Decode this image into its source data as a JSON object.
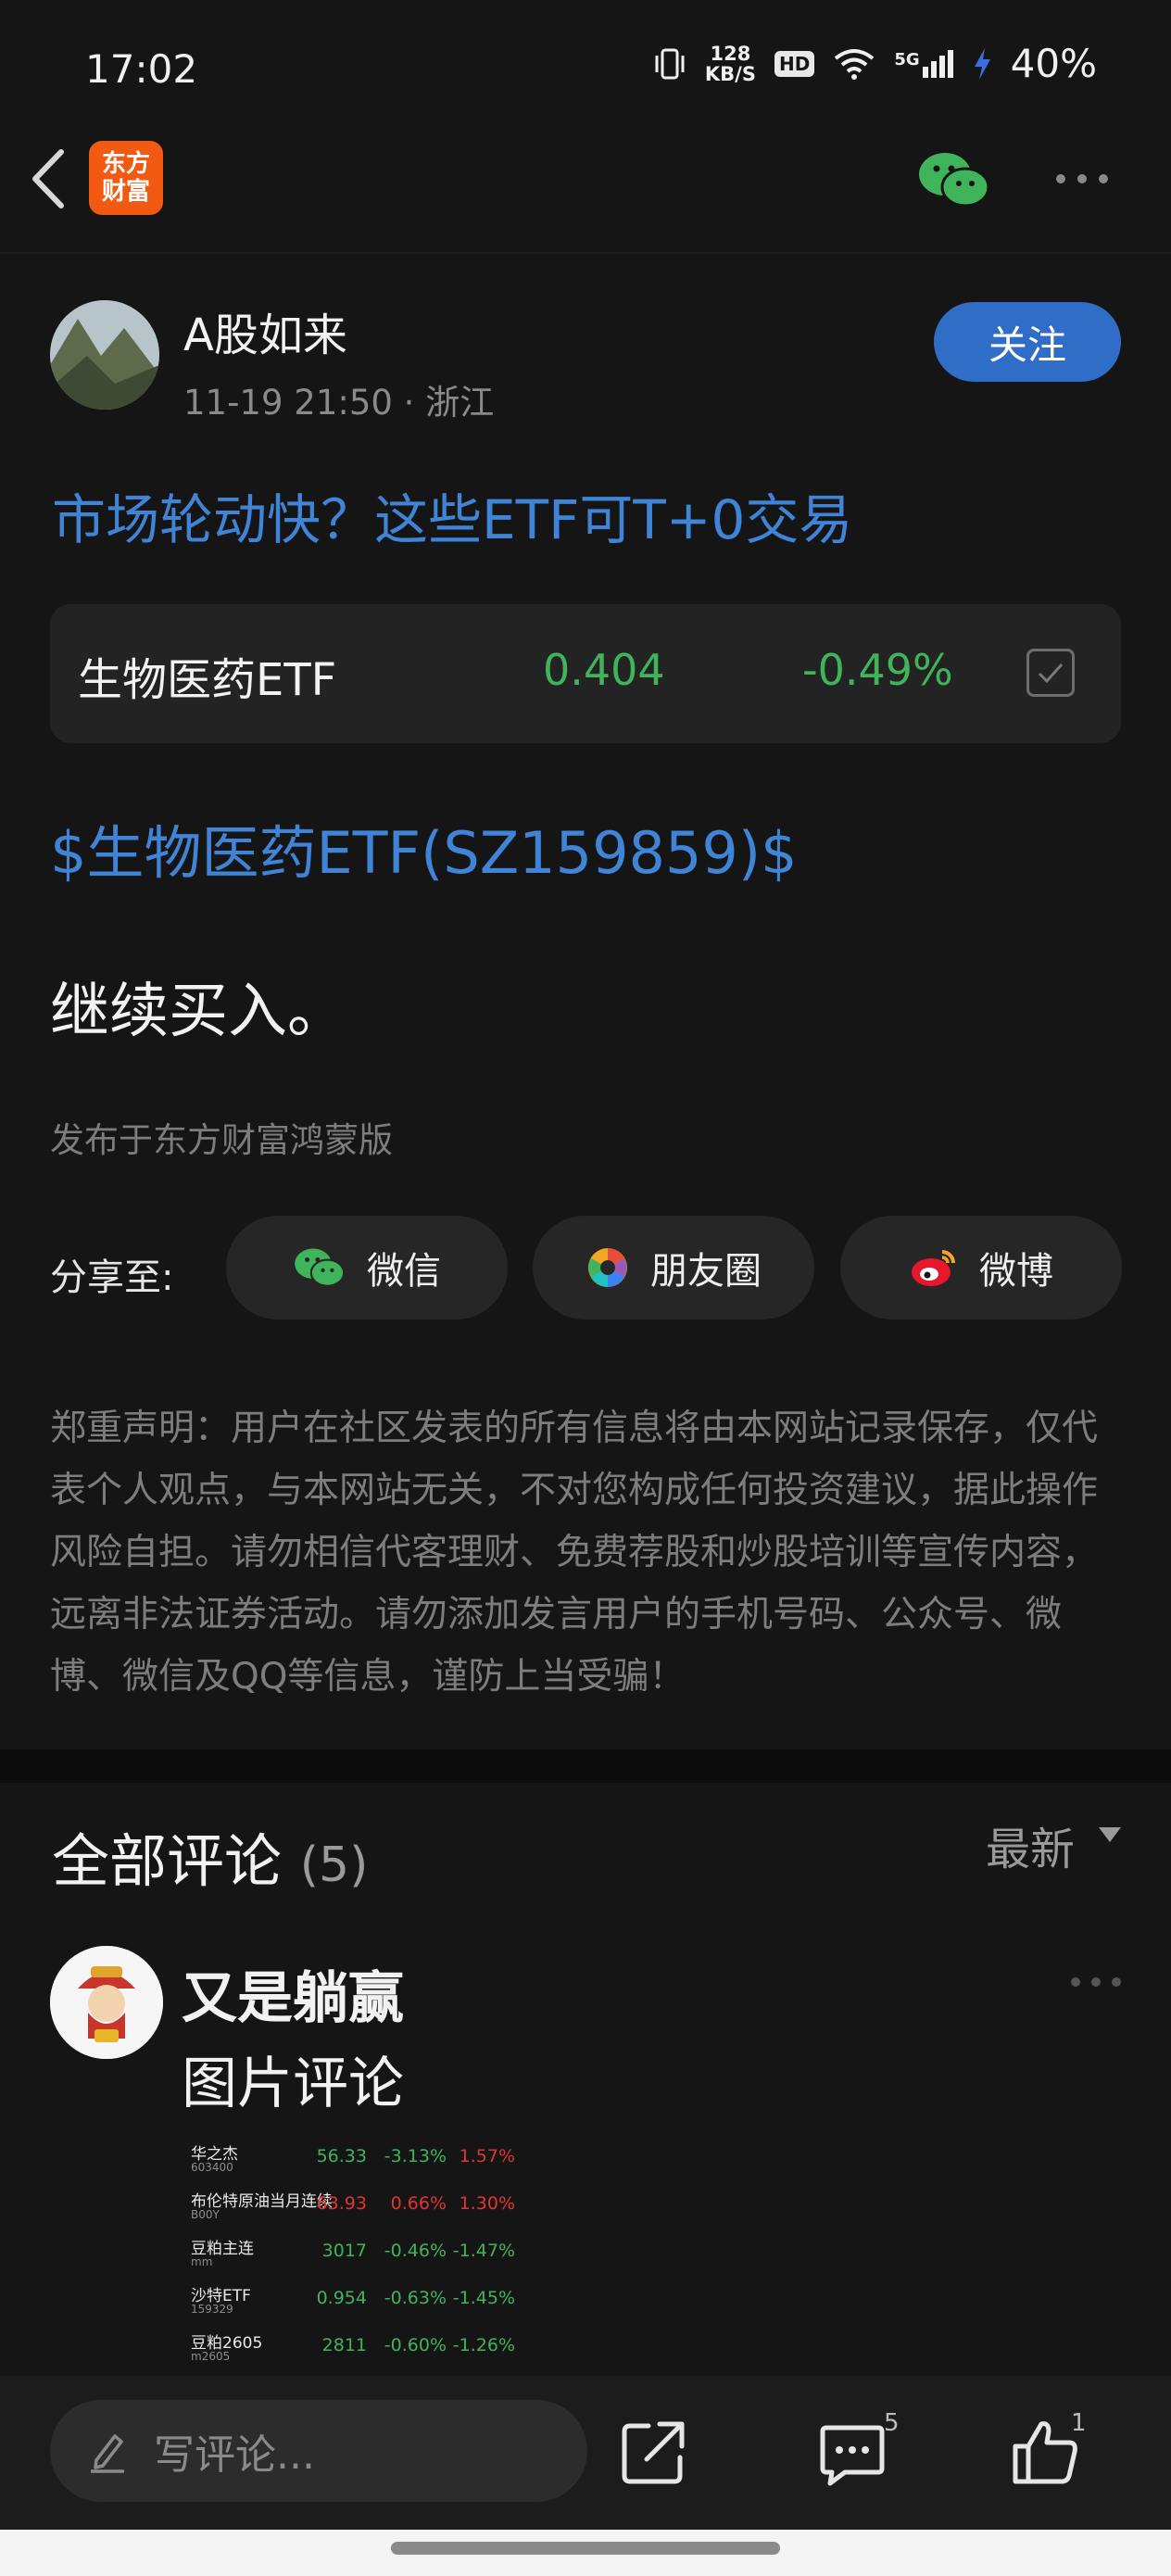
{
  "status_bar": {
    "time": "17:02",
    "net_speed_value": "128",
    "net_speed_unit": "KB/S",
    "hd": "HD",
    "network": "5G",
    "battery": "40%"
  },
  "header": {
    "logo_line1": "东方",
    "logo_line2": "财富",
    "icons": [
      "back-icon",
      "wechat-icon",
      "more-icon"
    ]
  },
  "post": {
    "author": "A股如来",
    "date": "11-19 21:50",
    "location": "· 浙江",
    "follow_label": "关注",
    "title": "市场轮动快？这些ETF可T+0交易",
    "stock": {
      "name": "生物医药ETF",
      "price": "0.404",
      "change": "-0.49%"
    },
    "stock_tag": "$生物医药ETF(SZ159859)$",
    "body": "继续买入。",
    "source": "发布于东方财富鸿蒙版"
  },
  "share": {
    "label": "分享至:",
    "targets": [
      {
        "label": "微信",
        "icon": "wechat-icon"
      },
      {
        "label": "朋友圈",
        "icon": "moments-icon"
      },
      {
        "label": "微博",
        "icon": "weibo-icon"
      }
    ]
  },
  "disclaimer": "郑重声明：用户在社区发表的所有信息将由本网站记录保存，仅代表个人观点，与本网站无关，不对您构成任何投资建议，据此操作风险自担。请勿相信代客理财、免费荐股和炒股培训等宣传内容，远离非法证券活动。请勿添加发言用户的手机号码、公众号、微博、微信及QQ等信息，谨防上当受骗！",
  "comments": {
    "title": "全部评论",
    "count": "(5)",
    "sort": "最新",
    "items": [
      {
        "user": "又是躺赢",
        "text": "图片评论",
        "quotes": [
          {
            "name": "华之杰",
            "code": "603400",
            "price": "56.33",
            "change": "-3.13%",
            "pct": "1.57%",
            "colors": [
              "g",
              "g",
              "r"
            ]
          },
          {
            "name": "布伦特原油当月连续",
            "code": "B00Y",
            "price": "63.93",
            "change": "0.66%",
            "pct": "1.30%",
            "colors": [
              "r",
              "r",
              "r"
            ]
          },
          {
            "name": "豆粕主连",
            "code": "mm",
            "price": "3017",
            "change": "-0.46%",
            "pct": "-1.47%",
            "colors": [
              "g",
              "g",
              "g"
            ]
          },
          {
            "name": "沙特ETF",
            "code": "159329",
            "price": "0.954",
            "change": "-0.63%",
            "pct": "-1.45%",
            "colors": [
              "g",
              "g",
              "g"
            ]
          },
          {
            "name": "豆粕2605",
            "code": "m2605",
            "price": "2811",
            "change": "-0.60%",
            "pct": "-1.26%",
            "colors": [
              "g",
              "g",
              "g"
            ]
          }
        ]
      }
    ]
  },
  "bottom_bar": {
    "placeholder": "写评论...",
    "comment_count": "5",
    "like_count": "1"
  }
}
